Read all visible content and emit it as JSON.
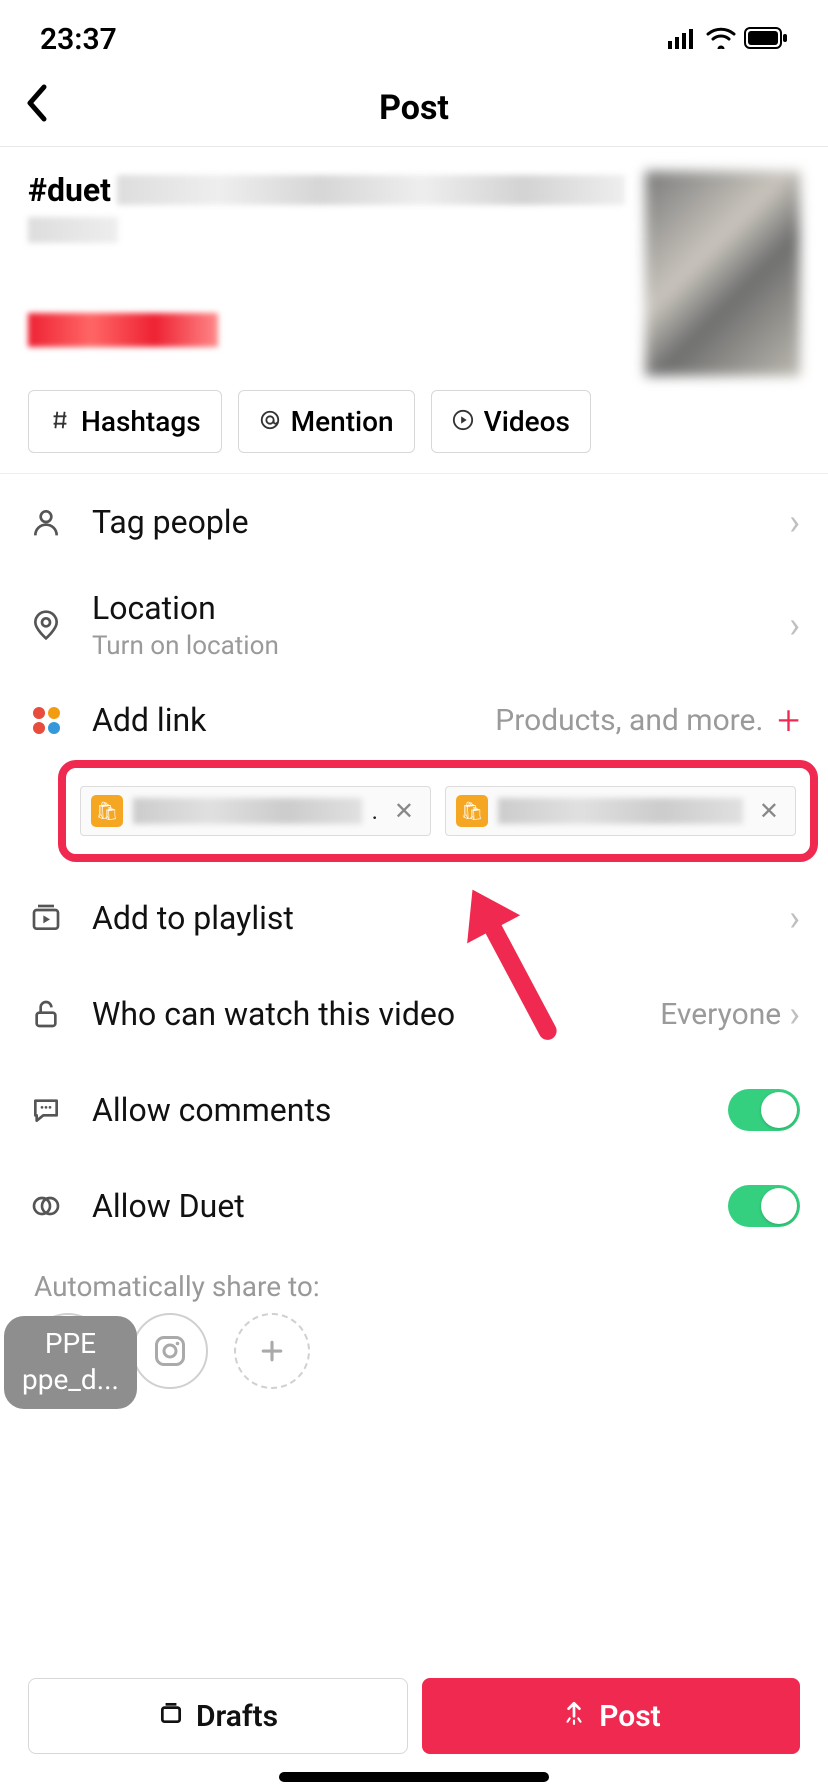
{
  "status": {
    "time": "23:37"
  },
  "nav": {
    "title": "Post"
  },
  "caption": {
    "hashtag": "#duet"
  },
  "chips": {
    "hashtags": "Hashtags",
    "mention": "Mention",
    "videos": "Videos"
  },
  "rows": {
    "tag_people": "Tag people",
    "location": "Location",
    "location_sub": "Turn on location",
    "add_link": "Add link",
    "add_link_hint": "Products, and more.",
    "add_playlist": "Add to playlist",
    "who_watch": "Who can watch this video",
    "who_watch_value": "Everyone",
    "allow_comments": "Allow comments",
    "allow_duet": "Allow Duet"
  },
  "share": {
    "label": "Automatically share to:"
  },
  "ppe": {
    "line1": "PPE",
    "line2": "ppe_d..."
  },
  "buttons": {
    "drafts": "Drafts",
    "post": "Post"
  },
  "toggles": {
    "comments": true,
    "duet": true
  },
  "link_chips": [
    {
      "trailing_dot": "."
    },
    {
      "trailing_dot": ""
    }
  ]
}
